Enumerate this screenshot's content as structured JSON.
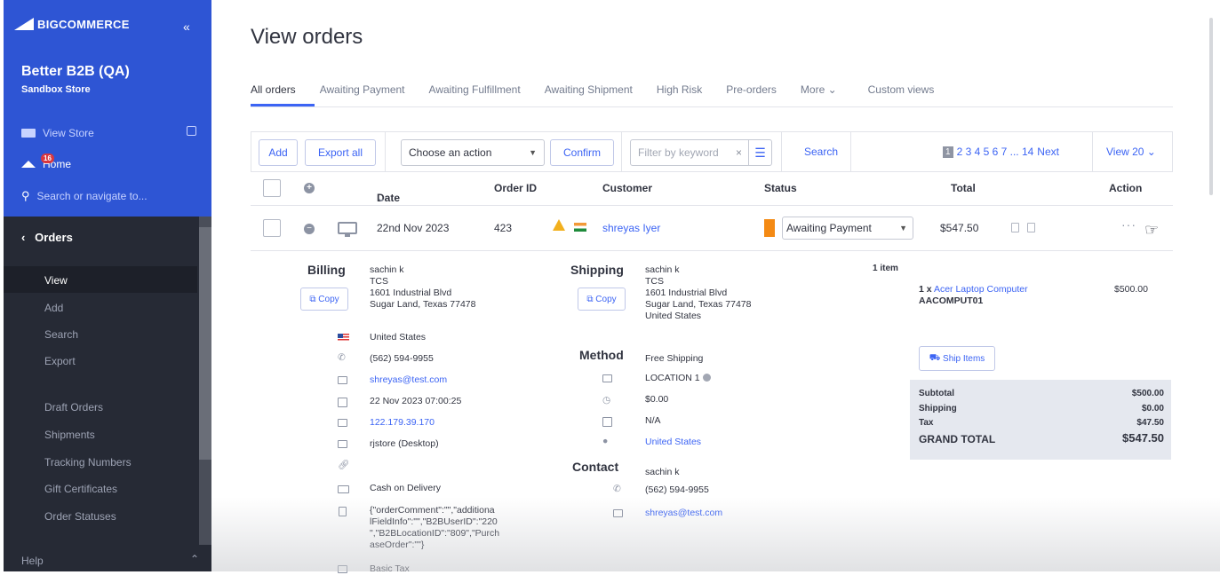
{
  "brand": {
    "logo_text": "COMMERCE",
    "logo_prefix": "BIG",
    "collapse_icon": "«"
  },
  "store": {
    "name": "Better B2B (QA)",
    "subtitle": "Sandbox Store"
  },
  "sidebar": {
    "view_store": "View Store",
    "home": "Home",
    "home_badge": "16",
    "search_placeholder": "Search or navigate to...",
    "section": "Orders",
    "items": [
      {
        "label": "View"
      },
      {
        "label": "Add"
      },
      {
        "label": "Search"
      },
      {
        "label": "Export"
      },
      {
        "label": "Draft Orders"
      },
      {
        "label": "Shipments"
      },
      {
        "label": "Tracking Numbers"
      },
      {
        "label": "Gift Certificates"
      },
      {
        "label": "Order Statuses"
      }
    ],
    "help": "Help"
  },
  "page": {
    "title": "View orders"
  },
  "tabs": [
    {
      "label": "All orders"
    },
    {
      "label": "Awaiting Payment"
    },
    {
      "label": "Awaiting Fulfillment"
    },
    {
      "label": "Awaiting Shipment"
    },
    {
      "label": "High Risk"
    },
    {
      "label": "Pre-orders"
    },
    {
      "label": "More ⌄"
    },
    {
      "label": "Custom views"
    }
  ],
  "toolbar": {
    "add": "Add",
    "export_all": "Export all",
    "action_select": "Choose an action",
    "confirm": "Confirm",
    "filter_placeholder": "Filter by keyword",
    "search": "Search",
    "pager_current": "1",
    "pager_pages": "2 3 4 5 6 7 ... 14",
    "pager_next": "Next",
    "view_count": "View 20 ⌄"
  },
  "table": {
    "headers": {
      "date": "Date",
      "date_sort": "⌄",
      "order_id": "Order ID",
      "customer": "Customer",
      "status": "Status",
      "total": "Total",
      "action": "Action"
    },
    "row": {
      "date": "22nd Nov 2023",
      "order_id": "423",
      "customer": "shreyas Iyer",
      "status": "Awaiting Payment",
      "total": "$547.50",
      "action_dots": "···"
    }
  },
  "billing": {
    "title": "Billing",
    "copy": "Copy",
    "name": "sachin k",
    "company": "TCS",
    "street": "1601 Industrial Blvd",
    "city": "Sugar Land, Texas 77478",
    "country": "United States",
    "phone": "(562) 594-9955",
    "email": "shreyas@test.com",
    "date": "22 Nov 2023 07:00:25",
    "ip": "122.179.39.170",
    "device": "rjstore (Desktop)",
    "payment": "Cash on Delivery",
    "meta": [
      "{\"orderComment\":\"\",\"additiona",
      "lFieldInfo\":\"\",\"B2BUserID\":\"220",
      "\",\"B2BLocationID\":\"809\",\"Purch",
      "aseOrder\":\"\"}"
    ],
    "tax": "Basic Tax"
  },
  "shipping": {
    "title": "Shipping",
    "copy": "Copy",
    "name": "sachin k",
    "company": "TCS",
    "street": "1601 Industrial Blvd",
    "city": "Sugar Land, Texas 77478",
    "country": "United States",
    "item_count": "1 item",
    "method_title": "Method",
    "method": "Free Shipping",
    "location": "LOCATION 1",
    "cost": "$0.00",
    "date": "N/A",
    "destination": "United States",
    "contact_title": "Contact",
    "contact_name": "sachin k",
    "contact_phone": "(562) 594-9955",
    "contact_email": "shreyas@test.com"
  },
  "items": {
    "qty": "1 x",
    "product": "Acer Laptop Computer",
    "sku": "AACOMPUT01",
    "price": "$500.00",
    "ship_items": "Ship Items"
  },
  "summary": {
    "subtotal_label": "Subtotal",
    "subtotal": "$500.00",
    "shipping_label": "Shipping",
    "shipping": "$0.00",
    "tax_label": "Tax",
    "tax": "$47.50",
    "grand_label": "GRAND TOTAL",
    "grand": "$547.50"
  },
  "colors": {
    "sidebar_top": "#2e55d4",
    "sidebar": "#262a35",
    "accent": "#3c64f4",
    "status_awaiting": "#f48a14"
  }
}
